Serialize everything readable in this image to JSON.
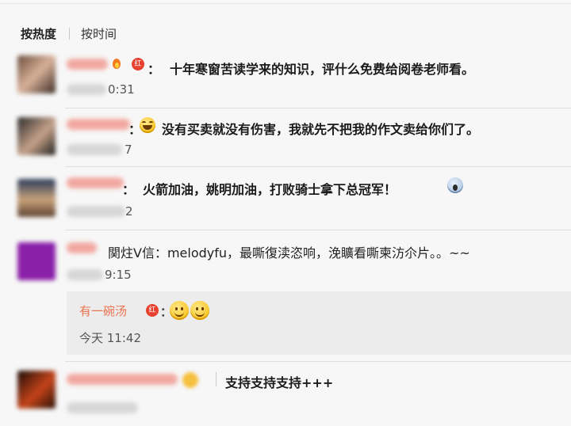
{
  "sort": {
    "hot": "按热度",
    "time": "按时间"
  },
  "comments": [
    {
      "text": "十年寒窗苦读学来的知识，评什么免费给阅卷老师看。",
      "time_tail": "0:31",
      "badge": "红"
    },
    {
      "text": "没有买卖就没有伤害，我就先不把我的作文卖给你们了。",
      "time_tail": "7"
    },
    {
      "text": "火箭加油，姚明加油，打败骑士拿下总冠军！",
      "time_tail": "2"
    },
    {
      "text": "関炷V信：melodyfu，最嘶復渎恣响，浼矌看嘶柬汸尒片。。~~",
      "time_tail": "9:15"
    },
    {
      "text": "支持支持支持+++"
    }
  ],
  "reply": {
    "name": "有一碗汤",
    "badge": "红",
    "time": "今天 11:42"
  },
  "colon": "：",
  "colors": {
    "accent": "#eb7350",
    "badge": "#e8412f"
  },
  "icons": [
    "laugh-emoji-icon",
    "scared-emoji-icon",
    "smile-emoji-icon",
    "fire-icon",
    "red-badge-icon"
  ]
}
